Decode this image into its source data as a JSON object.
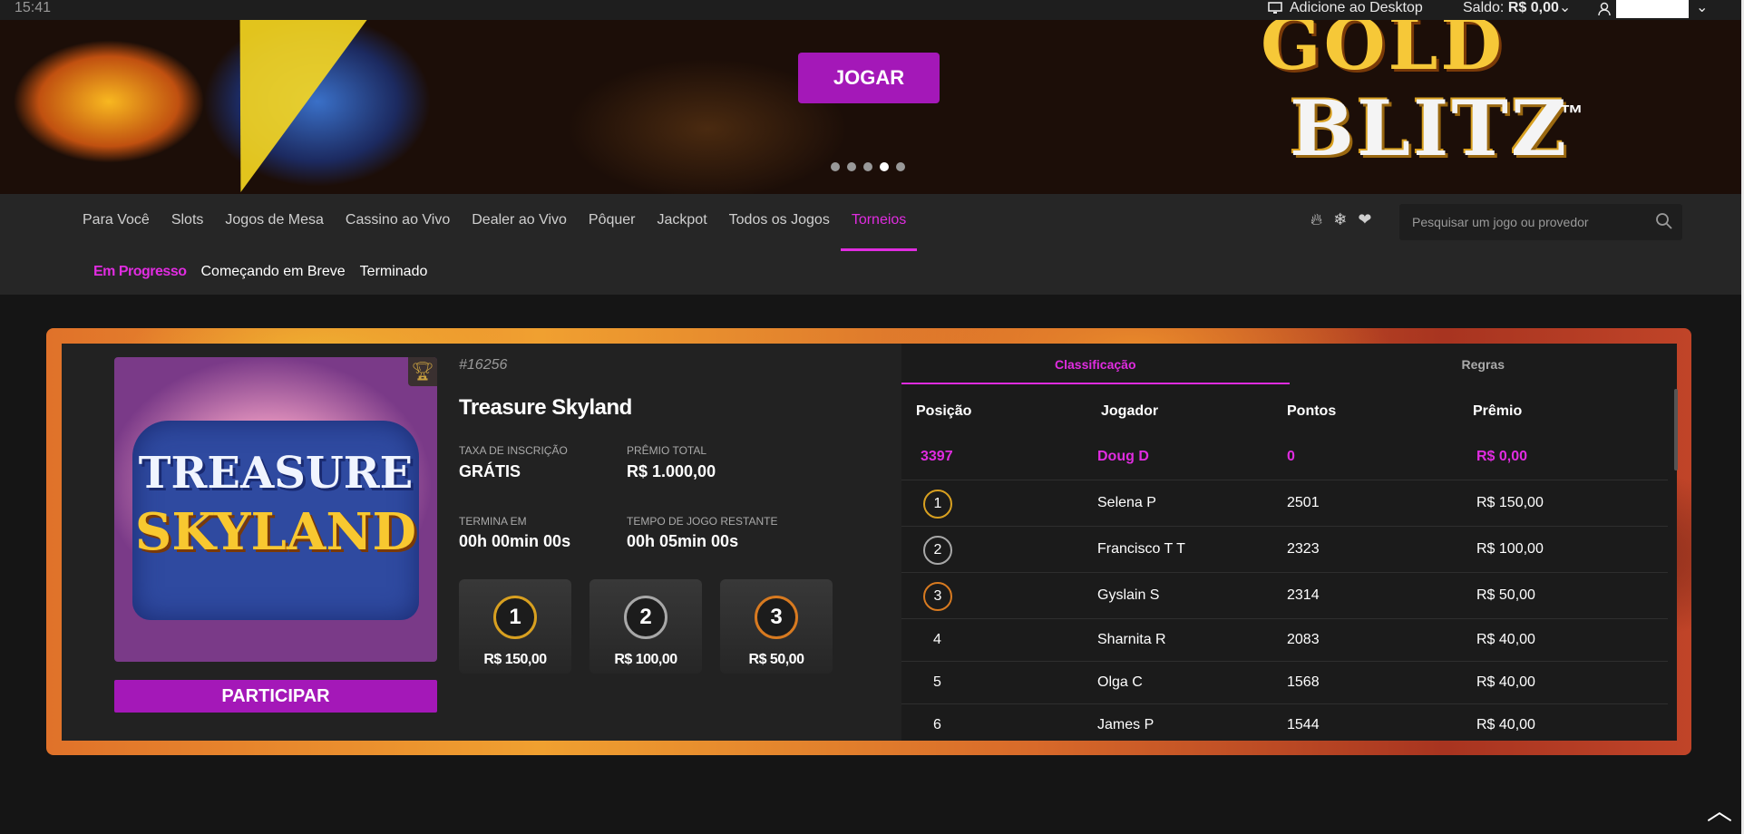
{
  "topbar": {
    "clock": "15:41",
    "add_desktop": "Adicione ao Desktop",
    "balance_label": "Saldo:",
    "balance_value": "R$ 0,00"
  },
  "banner": {
    "logo_line1": "GOLD",
    "logo_line2": "BLITZ",
    "logo_tm": "™",
    "play_label": "JOGAR",
    "slide_count": 5,
    "active_slide": 4
  },
  "nav": {
    "items": [
      {
        "label": "Para Você"
      },
      {
        "label": "Slots"
      },
      {
        "label": "Jogos de Mesa"
      },
      {
        "label": "Cassino ao Vivo"
      },
      {
        "label": "Dealer ao Vivo"
      },
      {
        "label": "Pôquer"
      },
      {
        "label": "Jackpot"
      },
      {
        "label": "Todos os Jogos"
      },
      {
        "label": "Torneios"
      }
    ],
    "subtabs": [
      {
        "label": "Em Progresso"
      },
      {
        "label": "Começando em Breve"
      },
      {
        "label": "Terminado"
      }
    ],
    "search_placeholder": "Pesquisar um jogo ou provedor",
    "icons": [
      "fire-icon",
      "snowflake-icon",
      "heart-icon"
    ]
  },
  "tournament": {
    "thumb_line1": "TREASURE",
    "thumb_line2": "SKYLAND",
    "id": "#16256",
    "name": "Treasure Skyland",
    "fee_label": "TAXA DE INSCRIÇÃO",
    "fee_value": "GRÁTIS",
    "total_label": "PRÊMIO TOTAL",
    "total_value": "R$ 1.000,00",
    "ends_label": "TERMINA EM",
    "ends_value": "00h 00min 00s",
    "remaining_label": "TEMPO DE JOGO RESTANTE",
    "remaining_value": "00h 05min 00s",
    "prizes": [
      {
        "rank": "1",
        "amount": "R$ 150,00"
      },
      {
        "rank": "2",
        "amount": "R$ 100,00"
      },
      {
        "rank": "3",
        "amount": "R$ 50,00"
      }
    ],
    "join_label": "PARTICIPAR"
  },
  "leaderboard": {
    "tabs": [
      "Classificação",
      "Regras"
    ],
    "headers": [
      "Posição",
      "Jogador",
      "Pontos",
      "Prêmio"
    ],
    "me": {
      "pos": "3397",
      "player": "Doug D",
      "points": "0",
      "prize": "R$ 0,00"
    },
    "rows": [
      {
        "pos": "1",
        "player": "Selena P",
        "points": "2501",
        "prize": "R$ 150,00"
      },
      {
        "pos": "2",
        "player": "Francisco T T",
        "points": "2323",
        "prize": "R$ 100,00"
      },
      {
        "pos": "3",
        "player": "Gyslain S",
        "points": "2314",
        "prize": "R$ 50,00"
      },
      {
        "pos": "4",
        "player": "Sharnita R",
        "points": "2083",
        "prize": "R$ 40,00"
      },
      {
        "pos": "5",
        "player": "Olga C",
        "points": "1568",
        "prize": "R$ 40,00"
      },
      {
        "pos": "6",
        "player": "James P",
        "points": "1544",
        "prize": "R$ 40,00"
      }
    ]
  },
  "colors": {
    "accent": "#e02ce0",
    "button": "#a418b8",
    "gold": "#d8a020",
    "silver": "#a8a8a8",
    "bronze": "#d87a20"
  }
}
